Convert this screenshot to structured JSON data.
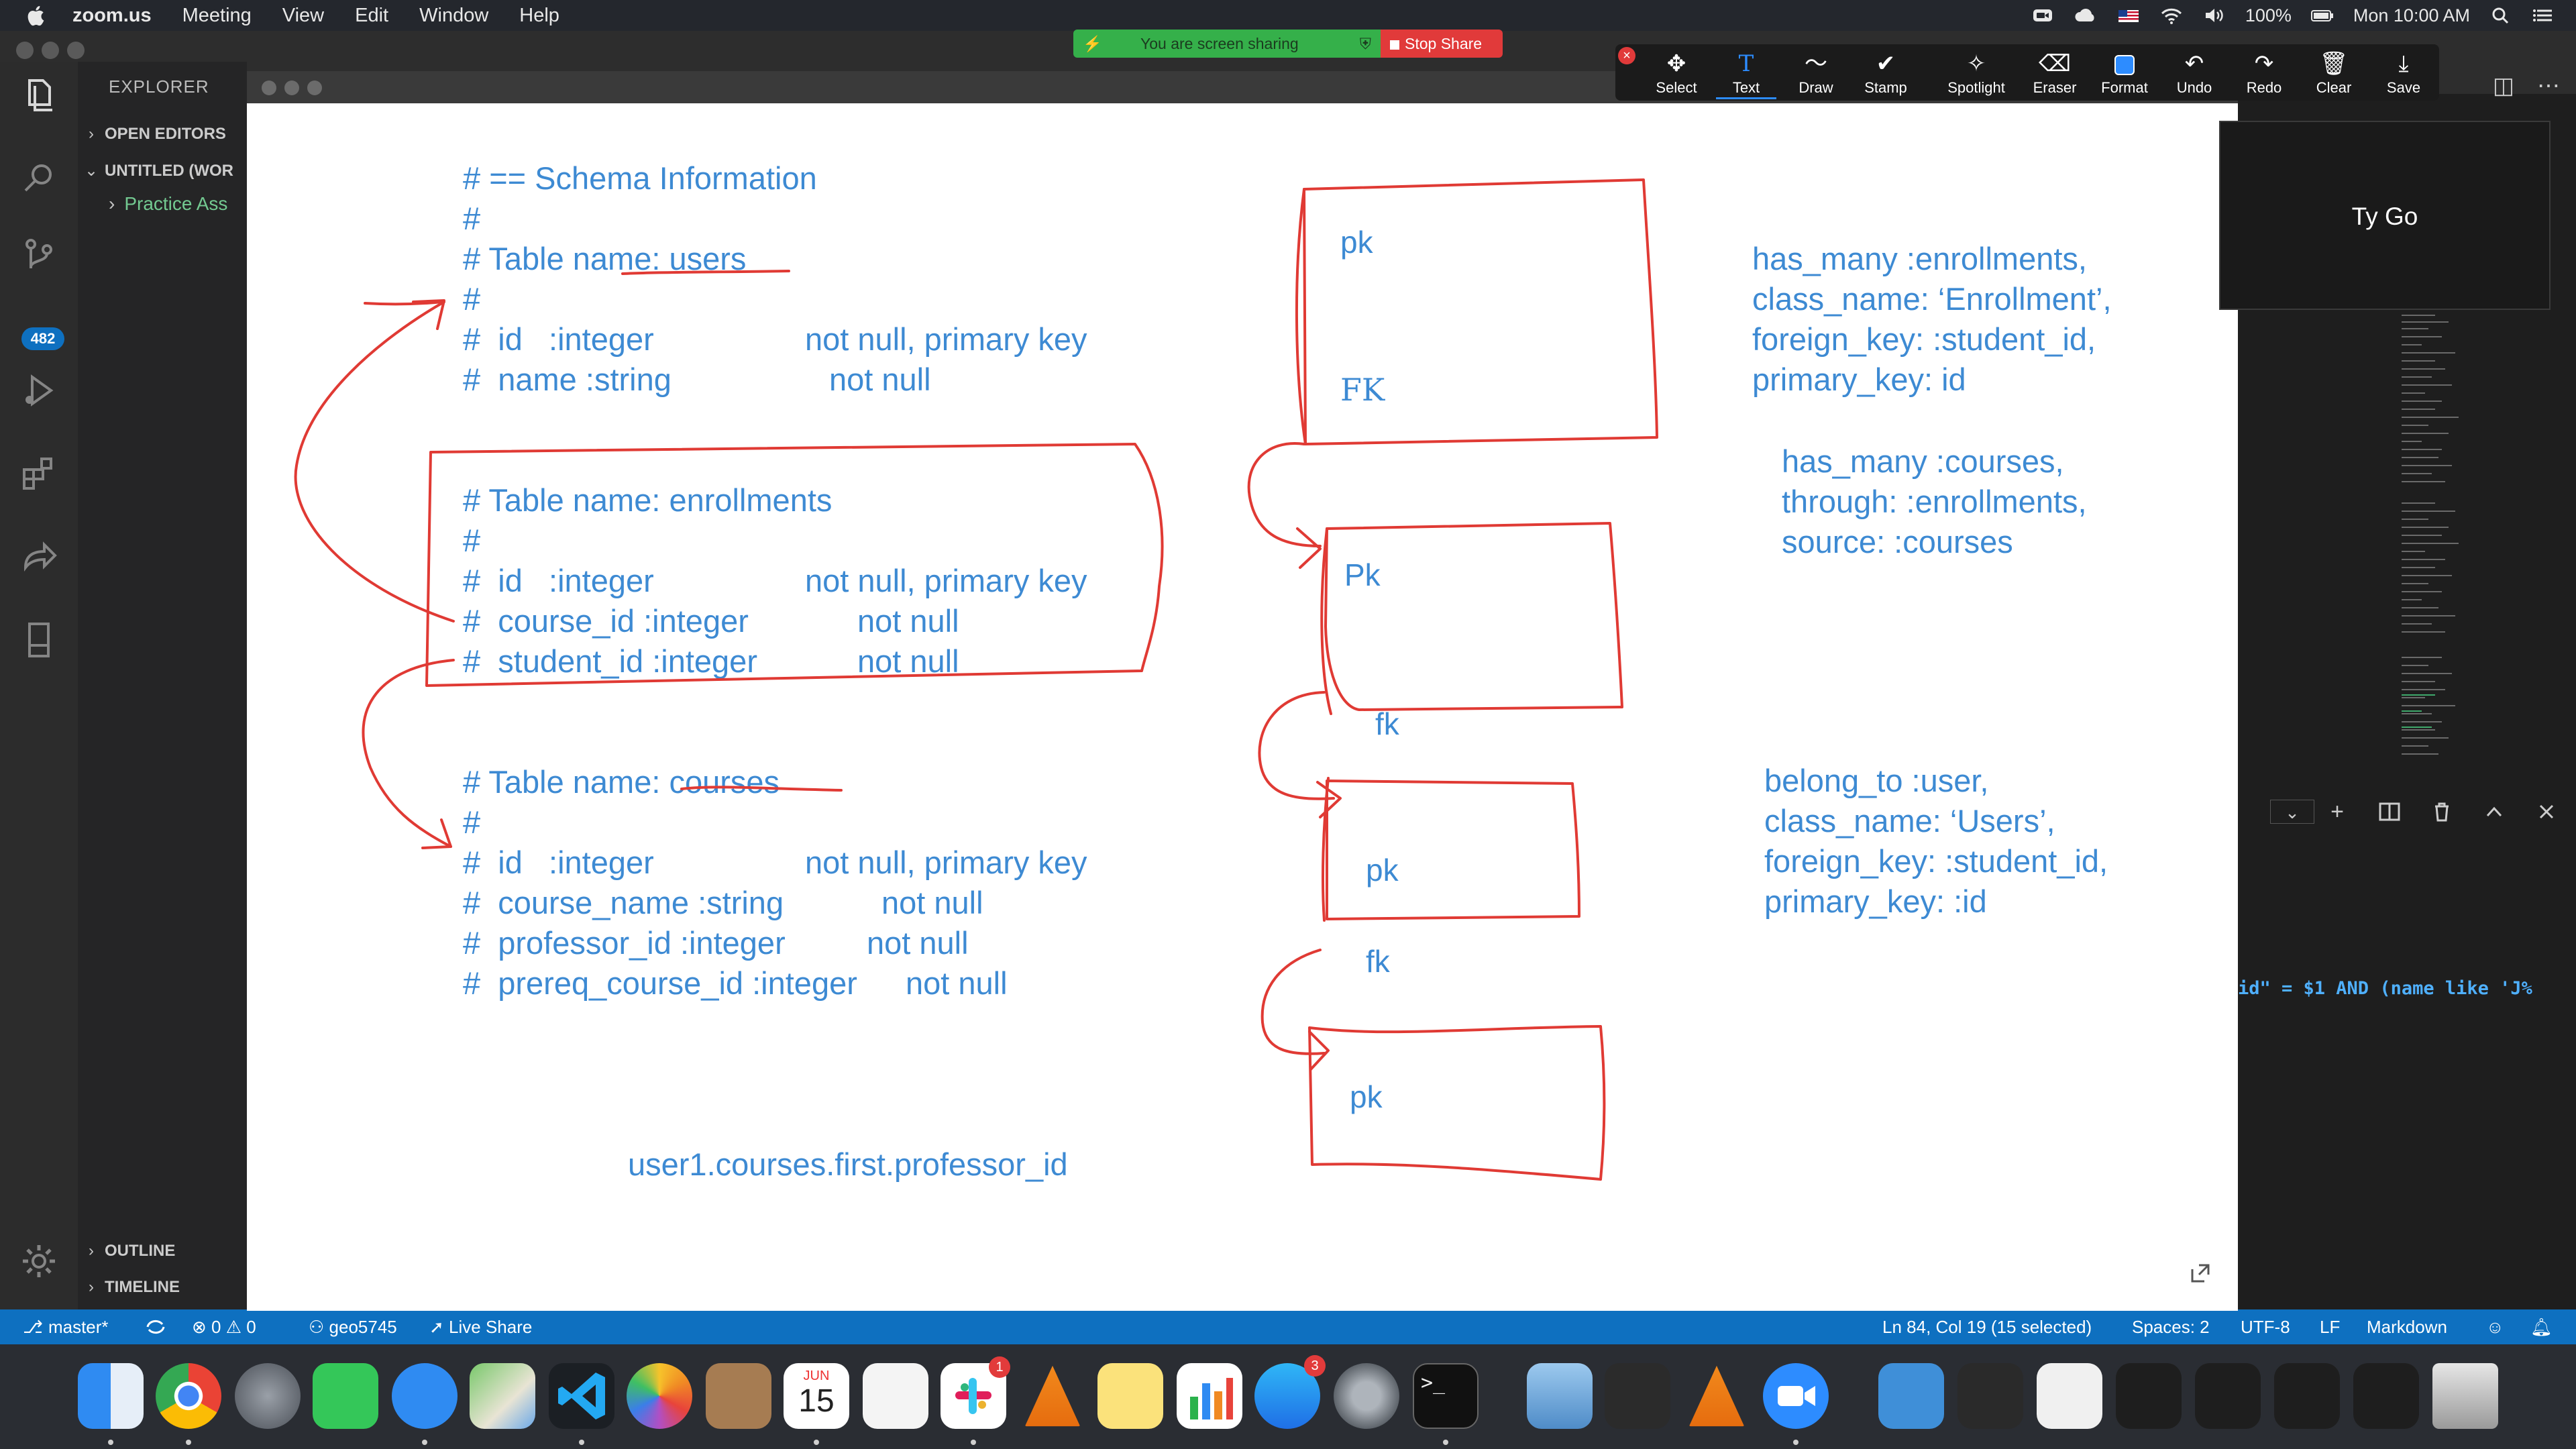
{
  "menubar": {
    "app": "zoom.us",
    "items": [
      "Meeting",
      "View",
      "Edit",
      "Window",
      "Help"
    ],
    "battery": "100%",
    "datetime": "Mon 10:00 AM"
  },
  "share_banner": {
    "status": "You are screen sharing",
    "stop": "Stop Share"
  },
  "annotation_tools": [
    "Select",
    "Text",
    "Draw",
    "Stamp",
    "Spotlight",
    "Eraser",
    "Format",
    "Undo",
    "Redo",
    "Clear",
    "Save"
  ],
  "participant": {
    "name": "Ty Go"
  },
  "vscode": {
    "activity_badge": "482",
    "sidebar": {
      "title": "EXPLORER",
      "open_editors": "OPEN EDITORS",
      "workspace": "UNTITLED (WOR",
      "file": "Practice Ass",
      "outline": "OUTLINE",
      "timeline": "TIMELINE"
    },
    "statusbar": {
      "branch": "master*",
      "problems": "0",
      "warnings": "0",
      "user": "geo5745",
      "live_share": "Live Share",
      "position": "Ln 84, Col 19 (15 selected)",
      "spaces": "Spaces: 2",
      "encoding": "UTF-8",
      "eol": "LF",
      "language": "Markdown"
    },
    "terminal_line": "id\" = $1 AND (name like 'J%"
  },
  "whiteboard": {
    "schema_lines": [
      "# == Schema Information",
      "#",
      "# Table name: users",
      "#",
      "#  id   :integer",
      "#  name :string",
      "# Table name: enrollments",
      "#",
      "#  id   :integer",
      "#  course_id :integer",
      "#  student_id :integer",
      "# Table name: courses",
      "#",
      "#  id   :integer",
      "#  course_name :string",
      "#  professor_id :integer",
      "#  prereq_course_id :integer"
    ],
    "constraints": [
      "not null, primary key",
      "not null",
      "not null, primary key",
      "not null",
      "not null",
      "not null, primary key",
      "not null",
      "not null",
      "not null"
    ],
    "example_call": "user1.courses.first.professor_id",
    "box_labels": [
      "pk",
      "FK",
      "Pk",
      "fk",
      "pk",
      "fk",
      "pk"
    ],
    "assoc_1": [
      "has_many :enrollments,",
      "class_name: ‘Enrollment’,",
      "foreign_key: :student_id,",
      "primary_key: id"
    ],
    "assoc_2": [
      "has_many :courses,",
      "through: :enrollments,",
      "source: :courses"
    ],
    "assoc_3": [
      "belong_to :user,",
      "class_name: ‘Users’,",
      "foreign_key: :student_id,",
      "primary_key: :id"
    ],
    "ink_color": "#e03a34",
    "text_color": "#3d8ad3"
  },
  "dock": {
    "apps": [
      "finder",
      "chrome",
      "launchpad",
      "facetime",
      "messages",
      "maps",
      "vscode",
      "photos",
      "contacts",
      "calendar",
      "reminders",
      "slack",
      "vlc",
      "notes",
      "numbers",
      "app-store",
      "system-preferences",
      "terminal",
      "preview",
      "printer",
      "vlc",
      "zoom",
      "downloads",
      "calendar-window",
      "mail-window",
      "window-a",
      "window-b",
      "window-c",
      "window-d",
      "trash"
    ],
    "calendar_day": "15",
    "calendar_month": "JUN",
    "slack_badge": "1",
    "appstore_badge": "3"
  }
}
